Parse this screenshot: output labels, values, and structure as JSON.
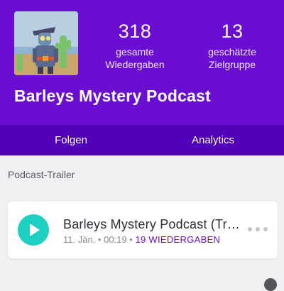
{
  "header": {
    "stats": [
      {
        "value": "318",
        "label_line1": "gesamte",
        "label_line2": "Wiedergaben"
      },
      {
        "value": "13",
        "label_line1": "geschätzte",
        "label_line2": "Zielgruppe"
      }
    ],
    "podcast_title": "Barleys Mystery Podcast",
    "background_color": "#6a0fd2"
  },
  "tabs": [
    {
      "label": "Folgen"
    },
    {
      "label": "Analytics"
    }
  ],
  "trailer_section": {
    "label": "Podcast-Trailer",
    "episode": {
      "title": "Barleys Mystery Podcast  (Trailer)",
      "date": "11. Jän.",
      "duration": "00:19",
      "plays": "19 WIEDERGABEN"
    }
  },
  "colors": {
    "accent": "#6a0fd2",
    "play_button": "#1ed0c2"
  },
  "icons": {
    "play": "play-icon",
    "more": "more-icon"
  }
}
